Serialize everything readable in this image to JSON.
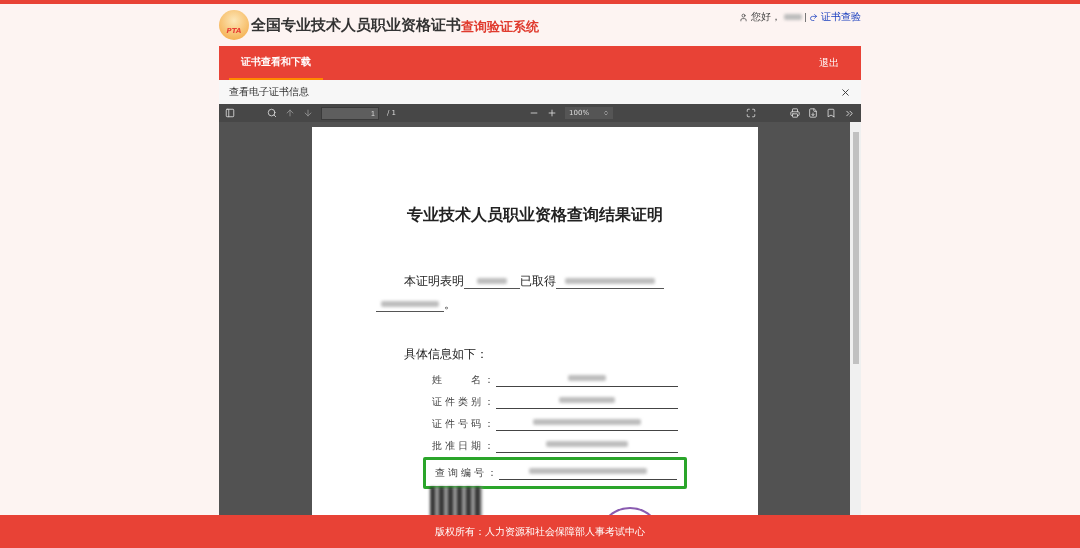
{
  "header": {
    "logo_text": "PTA",
    "title": "全国专业技术人员职业资格证书",
    "title_highlight": "查询验证系统",
    "greeting": "您好，",
    "link": "证书查验"
  },
  "nav": {
    "tabs": [
      {
        "label": "证书查看和下载",
        "selected": true
      }
    ],
    "logout": "退出"
  },
  "dialog": {
    "title": "查看电子证书信息"
  },
  "viewer": {
    "page_input": "1",
    "page_count": "/ 1",
    "zoom": "100%"
  },
  "document": {
    "title": "专业技术人员职业资格查询结果证明",
    "statement_start": "本证明表明",
    "statement_middle": "已取得",
    "statement_end": "。",
    "info_heading": "具体信息如下：",
    "fields": [
      {
        "label": "姓　　名：",
        "highlighted": false
      },
      {
        "label": "证件类别：",
        "highlighted": false
      },
      {
        "label": "证件号码：",
        "highlighted": false
      },
      {
        "label": "批准日期：",
        "highlighted": false
      },
      {
        "label": "查询编号：",
        "highlighted": true
      }
    ]
  },
  "footer": "版权所有：人力资源和社会保障部人事考试中心"
}
